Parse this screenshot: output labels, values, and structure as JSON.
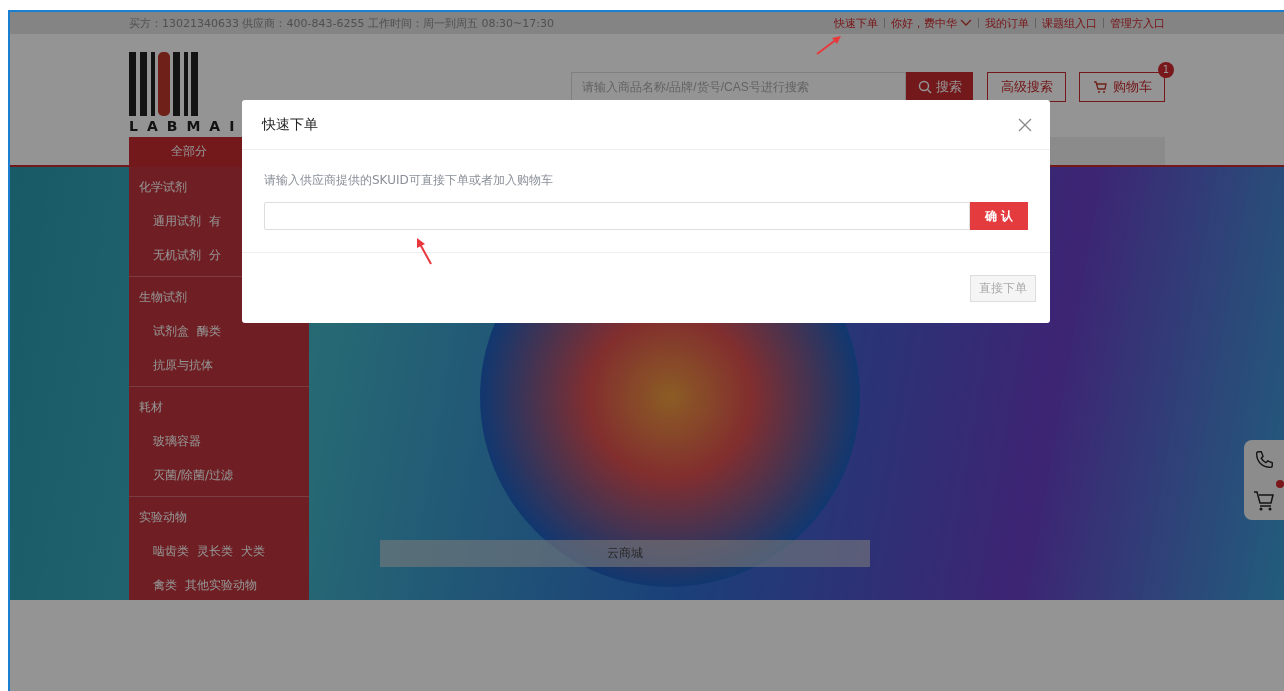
{
  "top_bar": {
    "info": "买方：13021340633 供应商：400-843-6255 工作时间：周一到周五 08:30~17:30",
    "links": [
      {
        "label": "快速下单",
        "kind": "link"
      },
      {
        "label": "你好，费中华",
        "kind": "dropdown"
      },
      {
        "label": "我的订单",
        "kind": "link"
      },
      {
        "label": "课题组入口",
        "kind": "link"
      },
      {
        "label": "管理方入口",
        "kind": "link"
      }
    ]
  },
  "header": {
    "logo_text": "LABMAI",
    "search": {
      "placeholder": "请输入商品名称/品牌/货号/CAS号进行搜索",
      "button": "搜索"
    },
    "advanced_search": "高级搜索",
    "cart": {
      "label": "购物车",
      "badge": "1"
    }
  },
  "nav": {
    "all_categories": "全部分"
  },
  "sidebar": {
    "groups": [
      {
        "title": "化学试剂",
        "rows": [
          [
            "通用试剂",
            "有"
          ],
          [
            "无机试剂",
            "分"
          ]
        ]
      },
      {
        "title": "生物试剂",
        "rows": [
          [
            "试剂盒",
            "酶类"
          ],
          [
            "抗原与抗体"
          ]
        ]
      },
      {
        "title": "耗材",
        "rows": [
          [
            "玻璃容器"
          ],
          [
            "灭菌/除菌/过滤"
          ]
        ]
      },
      {
        "title": "实验动物",
        "rows": [
          [
            "啮齿类",
            "灵长类",
            "犬类"
          ],
          [
            "禽类",
            "其他实验动物"
          ]
        ]
      }
    ]
  },
  "banner": {
    "caption": "云商城"
  },
  "modal": {
    "title": "快速下单",
    "hint": "请输入供应商提供的SKUID可直接下单或者加入购物车",
    "confirm": "确 认",
    "submit": {
      "label": "直接下单",
      "disabled": true
    }
  }
}
